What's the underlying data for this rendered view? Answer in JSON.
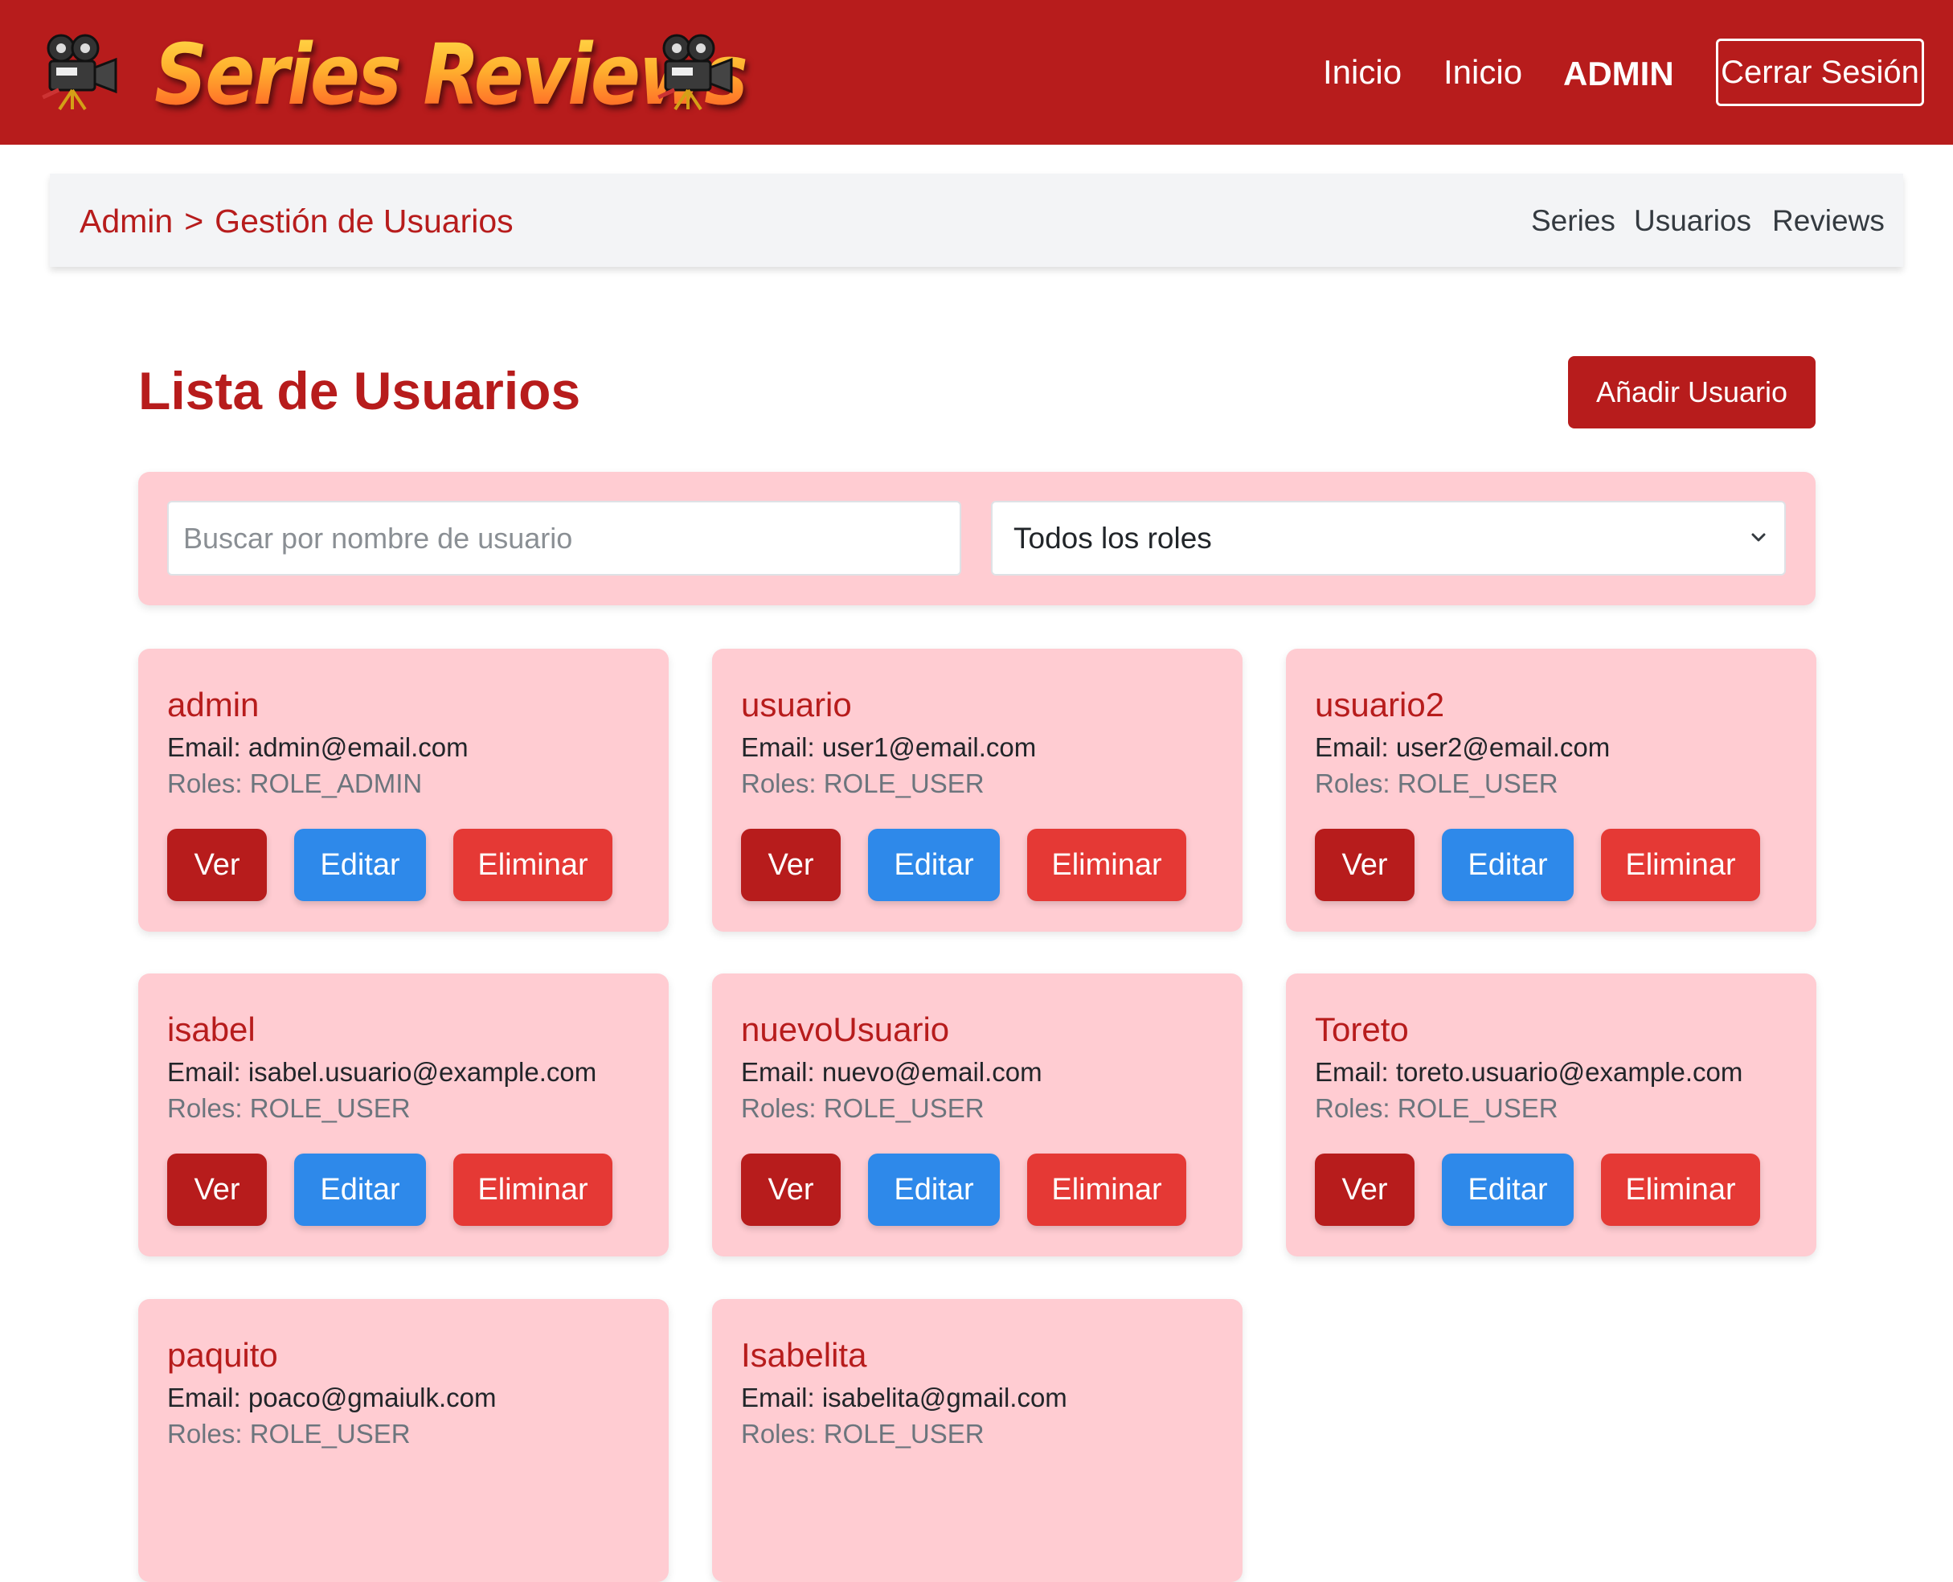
{
  "header": {
    "logo_text": "Series Reviews",
    "nav": [
      "Inicio",
      "Inicio",
      "ADMIN"
    ],
    "logout_label": "Cerrar Sesión"
  },
  "breadcrumb": {
    "root": "Admin",
    "separator": ">",
    "current": "Gestión de Usuarios"
  },
  "subnav": [
    "Series",
    "Usuarios",
    "Reviews"
  ],
  "page": {
    "title": "Lista de Usuarios",
    "add_label": "Añadir Usuario"
  },
  "filters": {
    "search_placeholder": "Buscar por nombre de usuario",
    "role_selected": "Todos los roles"
  },
  "actions": {
    "view": "Ver",
    "edit": "Editar",
    "delete": "Eliminar"
  },
  "users": [
    {
      "username": "admin",
      "email": "Email: admin@email.com",
      "roles": "Roles: ROLE_ADMIN"
    },
    {
      "username": "usuario",
      "email": "Email: user1@email.com",
      "roles": "Roles: ROLE_USER"
    },
    {
      "username": "usuario2",
      "email": "Email: user2@email.com",
      "roles": "Roles: ROLE_USER"
    },
    {
      "username": "isabel",
      "email": "Email: isabel.usuario@example.com",
      "roles": "Roles: ROLE_USER"
    },
    {
      "username": "nuevoUsuario",
      "email": "Email: nuevo@email.com",
      "roles": "Roles: ROLE_USER"
    },
    {
      "username": "Toreto",
      "email": "Email: toreto.usuario@example.com",
      "roles": "Roles: ROLE_USER"
    },
    {
      "username": "paquito",
      "email": "Email: poaco@gmaiulk.com",
      "roles": "Roles: ROLE_USER"
    },
    {
      "username": "Isabelita",
      "email": "Email: isabelita@gmail.com",
      "roles": "Roles: ROLE_USER"
    }
  ],
  "colors": {
    "brand_red": "#b71c1c",
    "card_pink": "#ffccd2",
    "edit_blue": "#2e89ea",
    "delete_red": "#e53935"
  },
  "icons": [
    "movie-camera-icon",
    "movie-camera-icon",
    "chevron-down-icon"
  ]
}
